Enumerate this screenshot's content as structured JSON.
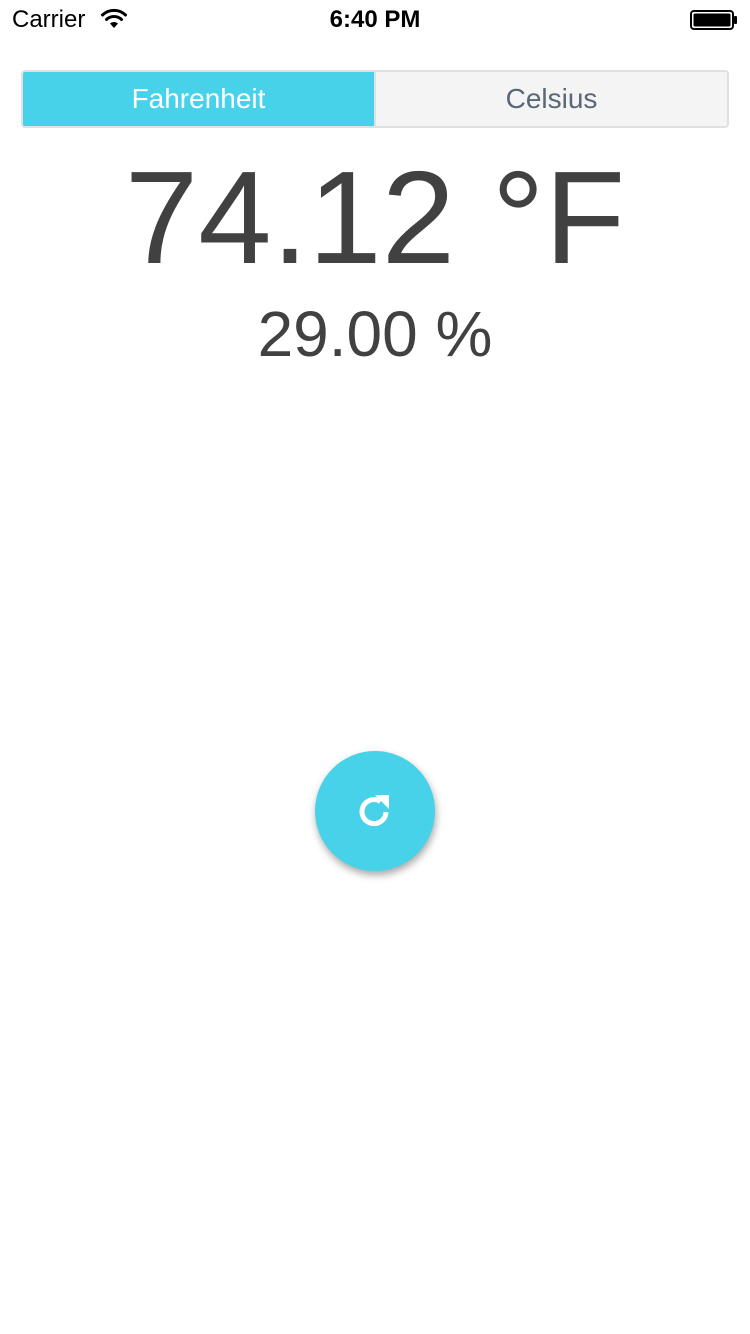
{
  "status_bar": {
    "carrier": "Carrier",
    "time": "6:40 PM",
    "icons": [
      "wifi-icon",
      "battery-icon"
    ]
  },
  "unit_toggle": {
    "options": [
      {
        "label": "Fahrenheit",
        "selected": true
      },
      {
        "label": "Celsius",
        "selected": false
      }
    ]
  },
  "reading": {
    "temperature": "74.12 °F",
    "humidity": "29.00 %"
  },
  "refresh_button": {
    "icon": "refresh-icon"
  },
  "colors": {
    "accent": "#48d2e9",
    "text": "#414141",
    "segment_inactive_bg": "#f4f4f4",
    "segment_inactive_text": "#5a6776"
  }
}
